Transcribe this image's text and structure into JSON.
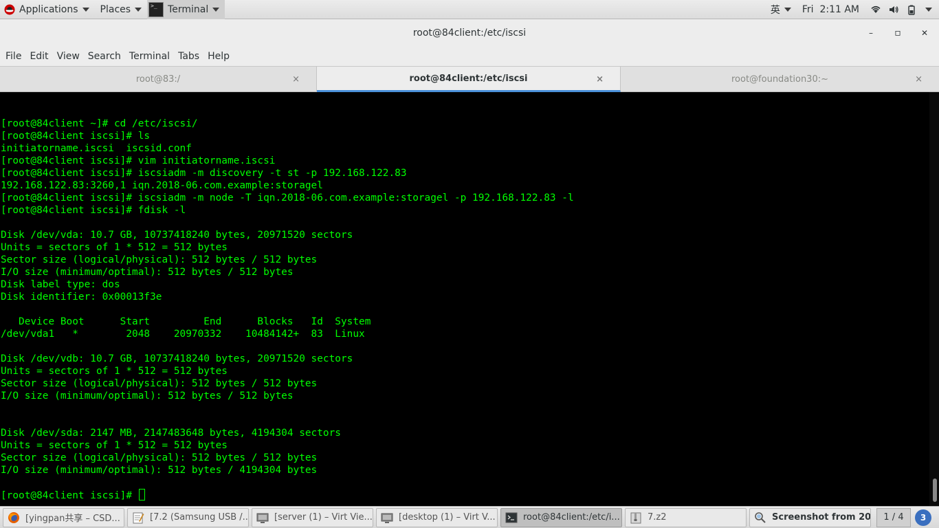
{
  "top_panel": {
    "applications": "Applications",
    "places": "Places",
    "terminal": "Terminal",
    "input_method": "英",
    "clock": "Fri  2:11 AM"
  },
  "window": {
    "title": "root@84client:/etc/iscsi",
    "minimize": "–",
    "maximize": "▫",
    "close": "✕"
  },
  "menubar": [
    "File",
    "Edit",
    "View",
    "Search",
    "Terminal",
    "Tabs",
    "Help"
  ],
  "tabs": [
    {
      "label": "root@83:/",
      "active": false
    },
    {
      "label": "root@84client:/etc/iscsi",
      "active": true
    },
    {
      "label": "root@foundation30:~",
      "active": false
    }
  ],
  "tab_close": "×",
  "terminal_lines": [
    "[root@84client ~]# cd /etc/iscsi/",
    "[root@84client iscsi]# ls",
    "initiatorname.iscsi  iscsid.conf",
    "[root@84client iscsi]# vim initiatorname.iscsi",
    "[root@84client iscsi]# iscsiadm -m discovery -t st -p 192.168.122.83",
    "192.168.122.83:3260,1 iqn.2018-06.com.example:storagel",
    "[root@84client iscsi]# iscsiadm -m node -T iqn.2018-06.com.example:storagel -p 192.168.122.83 -l",
    "[root@84client iscsi]# fdisk -l",
    "",
    "Disk /dev/vda: 10.7 GB, 10737418240 bytes, 20971520 sectors",
    "Units = sectors of 1 * 512 = 512 bytes",
    "Sector size (logical/physical): 512 bytes / 512 bytes",
    "I/O size (minimum/optimal): 512 bytes / 512 bytes",
    "Disk label type: dos",
    "Disk identifier: 0x00013f3e",
    "",
    "   Device Boot      Start         End      Blocks   Id  System",
    "/dev/vda1   *        2048    20970332    10484142+  83  Linux",
    "",
    "Disk /dev/vdb: 10.7 GB, 10737418240 bytes, 20971520 sectors",
    "Units = sectors of 1 * 512 = 512 bytes",
    "Sector size (logical/physical): 512 bytes / 512 bytes",
    "I/O size (minimum/optimal): 512 bytes / 512 bytes",
    "",
    "",
    "Disk /dev/sda: 2147 MB, 2147483648 bytes, 4194304 sectors",
    "Units = sectors of 1 * 512 = 512 bytes",
    "Sector size (logical/physical): 512 bytes / 512 bytes",
    "I/O size (minimum/optimal): 512 bytes / 4194304 bytes",
    ""
  ],
  "prompt": "[root@84client iscsi]# ",
  "taskbar": {
    "items": [
      {
        "label": "[yingpan共享 – CSD...",
        "icon": "firefox-icon",
        "active": false
      },
      {
        "label": "[7.2 (Samsung USB /...",
        "icon": "text-editor-icon",
        "active": false
      },
      {
        "label": "[server (1) – Virt Vie...",
        "icon": "virt-viewer-icon",
        "active": false
      },
      {
        "label": "[desktop (1) – Virt V...",
        "icon": "virt-viewer-icon",
        "active": false
      },
      {
        "label": "root@84client:/etc/i...",
        "icon": "terminal-icon",
        "active": true
      },
      {
        "label": "7.z2",
        "icon": "archive-icon",
        "active": false
      },
      {
        "label": "Screenshot from 20...",
        "icon": "screenshot-icon",
        "active": false
      }
    ],
    "pager": "1 / 4"
  },
  "colors": {
    "terminal_fg": "#00ff00",
    "terminal_bg": "#000000",
    "tab_accent": "#4a90d9"
  }
}
